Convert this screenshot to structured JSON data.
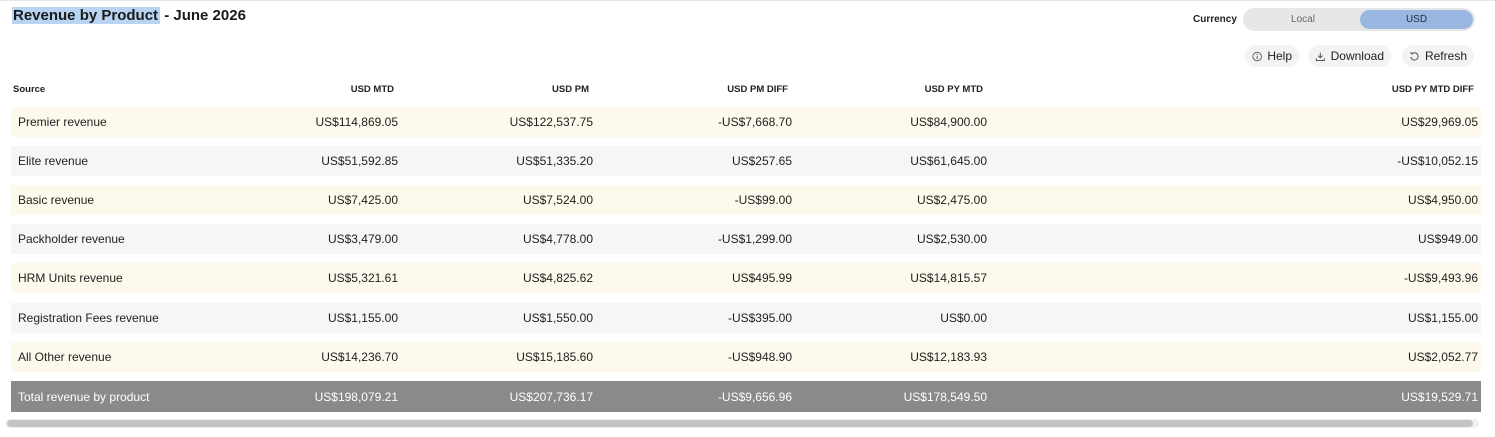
{
  "title": {
    "highlighted": "Revenue by Product",
    "rest": " - June 2026"
  },
  "currency": {
    "label": "Currency",
    "options": [
      "Local",
      "USD"
    ],
    "selected": "USD"
  },
  "toolbar": {
    "help": "Help",
    "download": "Download",
    "refresh": "Refresh"
  },
  "colors": {
    "row_odd": "#fdf9ec",
    "row_even": "#f5f6f8",
    "total_bg": "#8a8a8a",
    "toggle_selected": "#9ab7e2",
    "title_highlight": "#b9d3f3"
  },
  "table": {
    "columns": [
      "Source",
      "USD MTD",
      "USD PM",
      "USD PM DIFF",
      "USD PY MTD",
      "USD PY MTD DIFF"
    ],
    "rows": [
      [
        "Premier revenue",
        "US$114,869.05",
        "US$122,537.75",
        "-US$7,668.70",
        "US$84,900.00",
        "US$29,969.05"
      ],
      [
        "Elite revenue",
        "US$51,592.85",
        "US$51,335.20",
        "US$257.65",
        "US$61,645.00",
        "-US$10,052.15"
      ],
      [
        "Basic revenue",
        "US$7,425.00",
        "US$7,524.00",
        "-US$99.00",
        "US$2,475.00",
        "US$4,950.00"
      ],
      [
        "Packholder revenue",
        "US$3,479.00",
        "US$4,778.00",
        "-US$1,299.00",
        "US$2,530.00",
        "US$949.00"
      ],
      [
        "HRM Units revenue",
        "US$5,321.61",
        "US$4,825.62",
        "US$495.99",
        "US$14,815.57",
        "-US$9,493.96"
      ],
      [
        "Registration Fees revenue",
        "US$1,155.00",
        "US$1,550.00",
        "-US$395.00",
        "US$0.00",
        "US$1,155.00"
      ],
      [
        "All Other revenue",
        "US$14,236.70",
        "US$15,185.60",
        "-US$948.90",
        "US$12,183.93",
        "US$2,052.77"
      ]
    ],
    "total": [
      "Total revenue by product",
      "US$198,079.21",
      "US$207,736.17",
      "-US$9,656.96",
      "US$178,549.50",
      "US$19,529.71"
    ]
  }
}
